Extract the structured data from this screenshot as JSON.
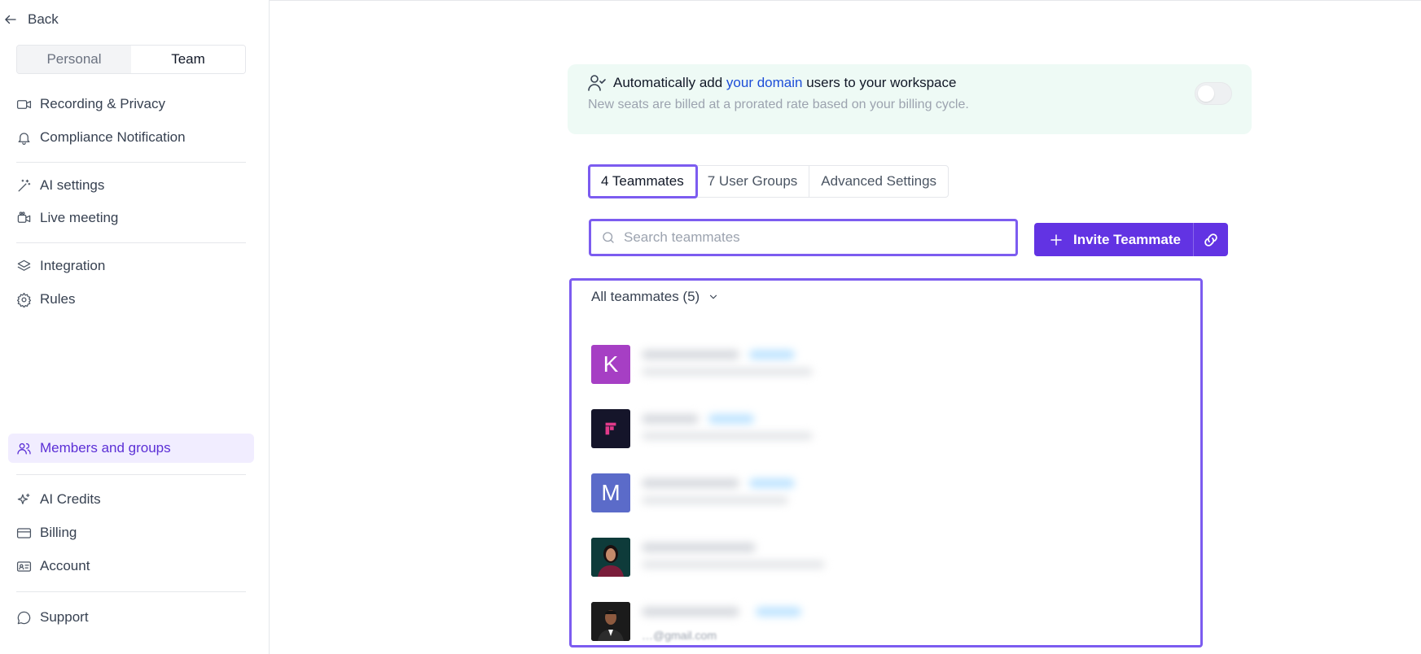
{
  "sidebar": {
    "back_label": "Back",
    "segment": {
      "personal": "Personal",
      "team": "Team",
      "selected": "Team"
    },
    "items": [
      {
        "label": "Recording & Privacy",
        "icon": "video-camera-icon"
      },
      {
        "label": "Compliance Notification",
        "icon": "bell-icon"
      },
      {
        "label": "AI settings",
        "icon": "magic-wand-icon"
      },
      {
        "label": "Live meeting",
        "icon": "live-camera-icon"
      },
      {
        "label": "Integration",
        "icon": "layers-icon"
      },
      {
        "label": "Rules",
        "icon": "gear-icon"
      },
      {
        "label": "Members and groups",
        "icon": "users-icon",
        "active": true
      },
      {
        "label": "AI Credits",
        "icon": "sparkle-icon"
      },
      {
        "label": "Billing",
        "icon": "credit-card-icon"
      },
      {
        "label": "Account",
        "icon": "id-card-icon"
      },
      {
        "label": "Support",
        "icon": "chat-bubble-icon"
      }
    ]
  },
  "banner": {
    "title_prefix": "Automatically add ",
    "title_link": "your domain",
    "title_suffix": " users to your workspace",
    "subtitle": "New seats are billed at a prorated rate based on your billing cycle.",
    "toggle_on": false
  },
  "tabs": [
    {
      "label": "4 Teammates",
      "active": true
    },
    {
      "label": "7 User Groups"
    },
    {
      "label": "Advanced Settings"
    }
  ],
  "search": {
    "placeholder": "Search teammates",
    "value": ""
  },
  "invite": {
    "label": "Invite Teammate"
  },
  "teammates": {
    "header": "All teammates (5)",
    "members": [
      {
        "initial": "K",
        "color": "#a63fc4"
      },
      {
        "initial": "",
        "color": "#15152a"
      },
      {
        "initial": "M",
        "color": "#5b6bc9"
      },
      {
        "initial": "",
        "color": "#0e3b3a"
      },
      {
        "initial": "",
        "color": "#1b1b1b",
        "email_peek": "…@gmail.com"
      }
    ]
  },
  "colors": {
    "accent": "#6233e3",
    "highlight_outline": "#7c5cf0",
    "active_nav_bg": "#f1edff"
  }
}
